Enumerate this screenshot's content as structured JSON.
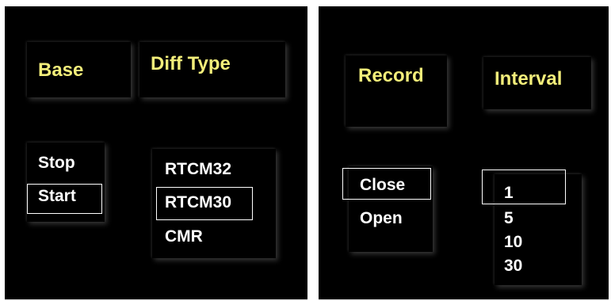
{
  "left": {
    "base": {
      "title": "Base",
      "options": [
        "Stop",
        "Start"
      ],
      "selected": "Start"
    },
    "diff_type": {
      "title": "Diff Type",
      "options": [
        "RTCM32",
        "RTCM30",
        "CMR"
      ],
      "selected": "RTCM30"
    }
  },
  "right": {
    "record": {
      "title": "Record",
      "options": [
        "Close",
        "Open"
      ],
      "selected": "Close"
    },
    "interval": {
      "title": "Interval",
      "options": [
        "1",
        "5",
        "10",
        "30"
      ],
      "selected": "1"
    }
  },
  "colors": {
    "title": "#f3ee7a",
    "option": "#ffffff",
    "background": "#000000"
  }
}
